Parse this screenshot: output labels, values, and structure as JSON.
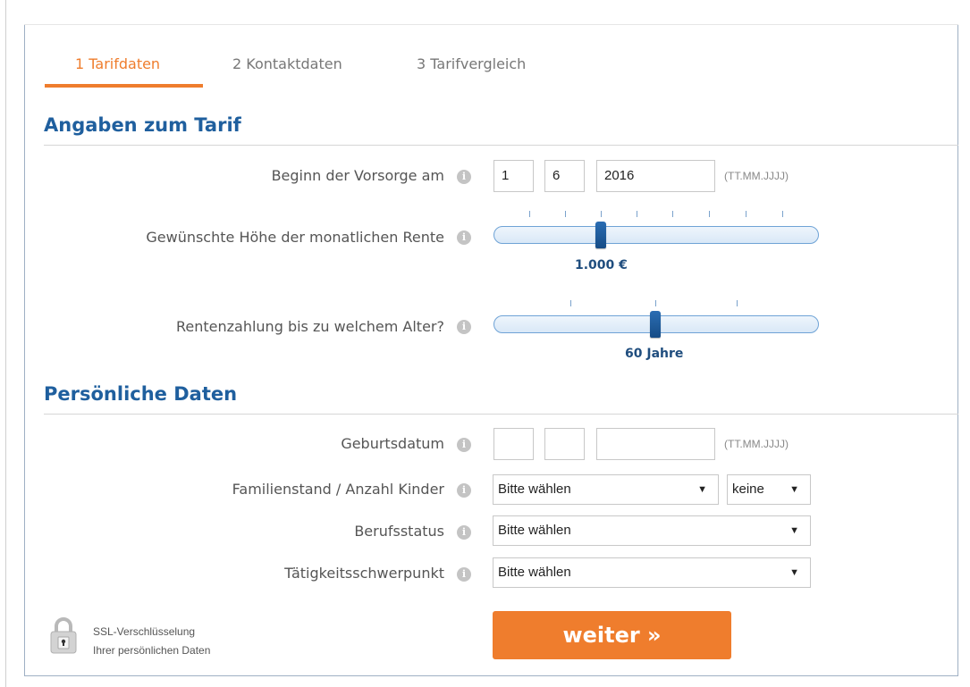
{
  "tabs": [
    {
      "label": "1 Tarifdaten",
      "active": true
    },
    {
      "label": "2 Kontaktdaten",
      "active": false
    },
    {
      "label": "3 Tarifvergleich",
      "active": false
    }
  ],
  "colors": {
    "accent": "#ef7d2d",
    "heading": "#1f5f9e",
    "slider_handle": "#1a5592"
  },
  "tarif": {
    "title": "Angaben zum Tarif",
    "beginn": {
      "label": "Beginn der Vorsorge am",
      "day": "1",
      "month": "6",
      "year": "2016",
      "hint": "(TT.MM.JJJJ)"
    },
    "rente": {
      "label": "Gewünschte Höhe der monatlichen Rente",
      "value": "1.000 €"
    },
    "alter": {
      "label": "Rentenzahlung bis zu welchem Alter?",
      "value": "60 Jahre"
    }
  },
  "personal": {
    "title": "Persönliche Daten",
    "geburtsdatum": {
      "label": "Geburtsdatum",
      "day": "",
      "month": "",
      "year": "",
      "hint": "(TT.MM.JJJJ)"
    },
    "familienstand": {
      "label": "Familienstand / Anzahl Kinder",
      "value": "Bitte wählen",
      "kinder": "keine"
    },
    "berufsstatus": {
      "label": "Berufsstatus",
      "value": "Bitte wählen"
    },
    "taetigkeit": {
      "label": "Tätigkeitsschwerpunkt",
      "value": "Bitte wählen"
    }
  },
  "icons": {
    "info": "info-icon",
    "dropdown": "chevron-down-icon",
    "lock": "lock-icon"
  },
  "info_glyph": "i",
  "dropdown_glyph": "▼",
  "ssl": {
    "line1": "SSL-Verschlüsselung",
    "line2": "Ihrer persönlichen Daten"
  },
  "submit_label": "weiter »"
}
